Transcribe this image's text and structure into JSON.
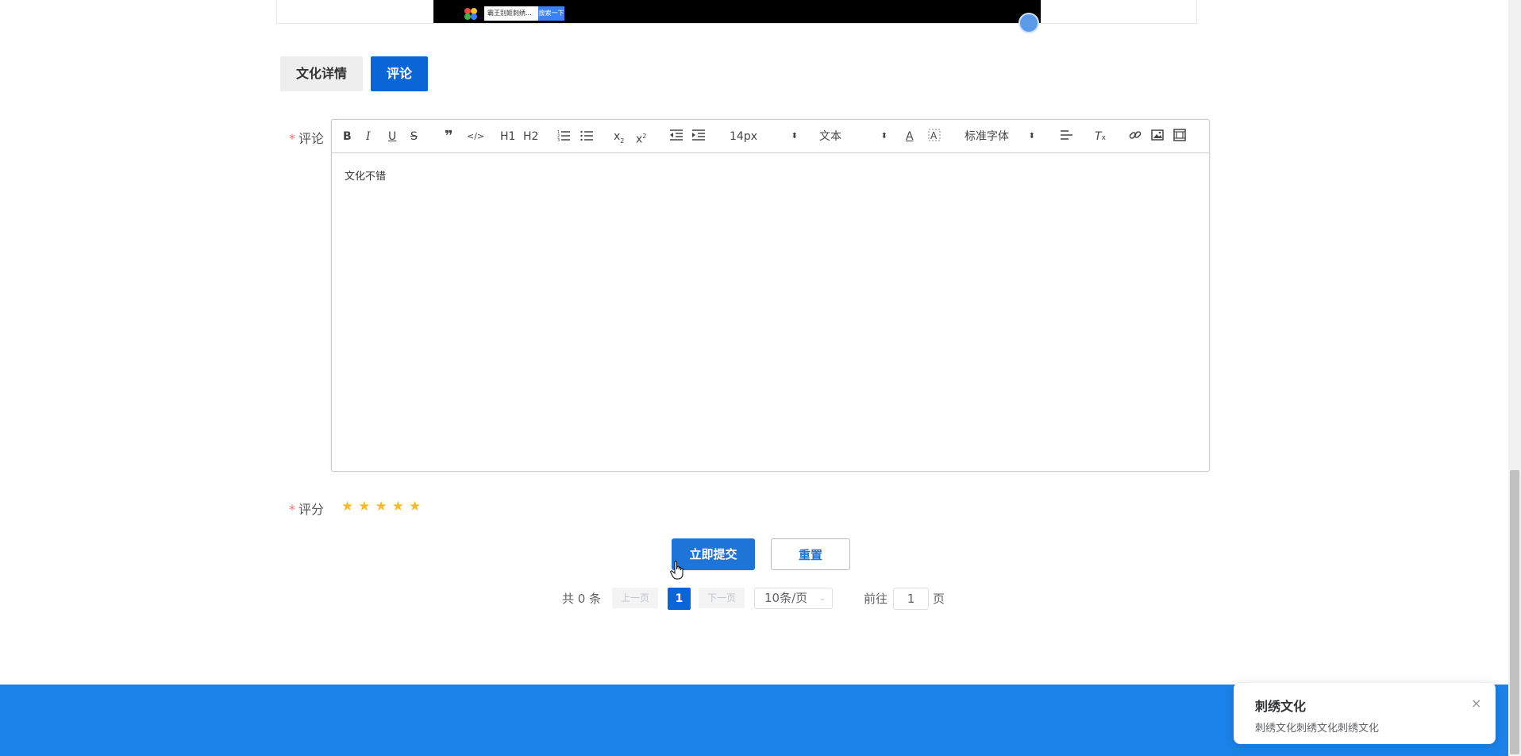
{
  "video": {
    "search_text": "霸王别姬刺绣...",
    "search_button": "搜索一下"
  },
  "tabs": [
    {
      "label": "文化详情",
      "active": false
    },
    {
      "label": "评论",
      "active": true
    }
  ],
  "form": {
    "comment_label": "评论",
    "rating_label": "评分",
    "required_mark": "*",
    "comment_value": "文化不错",
    "rating_value": 5,
    "rating_max": 5
  },
  "toolbar": {
    "font_size": "14px",
    "header_select": "文本",
    "font_family": "标准字体",
    "h1": "H1",
    "h2": "H2"
  },
  "buttons": {
    "submit": "立即提交",
    "reset": "重置"
  },
  "pagination": {
    "total": "共 0 条",
    "prev": "上一页",
    "next": "下一页",
    "current_page": "1",
    "page_size": "10条/页",
    "goto_label": "前往",
    "goto_value": "1",
    "page_suffix": "页"
  },
  "notification": {
    "title": "刺绣文化",
    "message": "刺绣文化刺绣文化刺绣文化",
    "close": "×"
  },
  "colors": {
    "primary": "#0a66d6",
    "footer": "#1a82e8",
    "star": "#f7ba2a",
    "required": "#f56c6c"
  }
}
